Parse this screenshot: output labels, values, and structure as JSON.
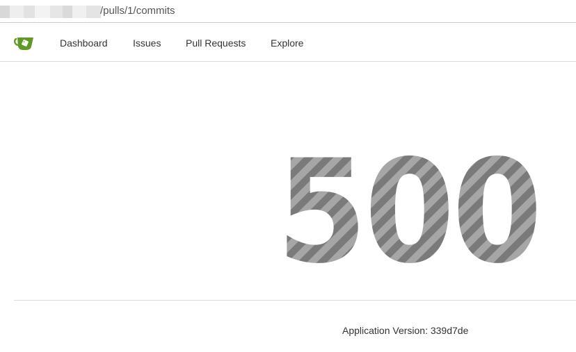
{
  "browser": {
    "url_visible": "/pulls/1/commits"
  },
  "nav": {
    "items": [
      {
        "label": "Dashboard"
      },
      {
        "label": "Issues"
      },
      {
        "label": "Pull Requests"
      },
      {
        "label": "Explore"
      }
    ],
    "logo_icon": "gitea-teacup-icon",
    "logo_color": "#609926"
  },
  "error": {
    "code": "500",
    "stripe_dark": "#7a7a7a",
    "stripe_light": "#a6a6a6"
  },
  "footer": {
    "version_text": "Application Version: 339d7de"
  }
}
